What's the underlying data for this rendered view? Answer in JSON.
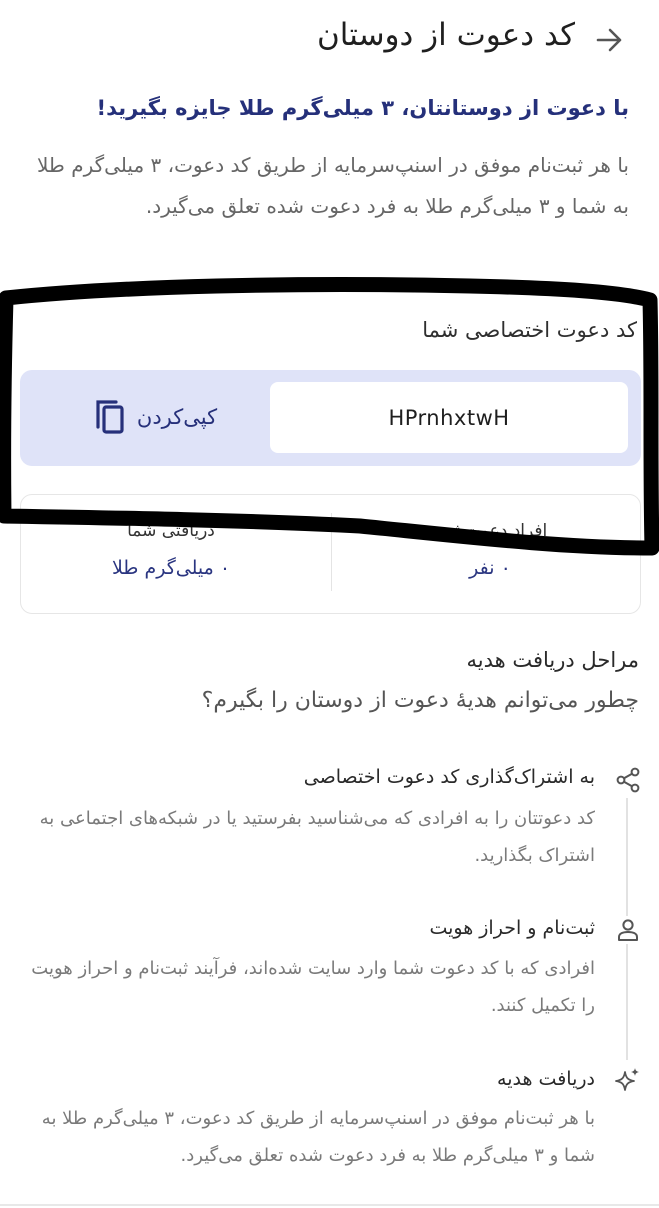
{
  "header": {
    "title": "کد دعوت از دوستان",
    "back_icon": "arrow-right-icon"
  },
  "promo": {
    "headline": "با دعوت از دوستانتان، ۳ میلی‌گرم طلا جایزه بگیرید!",
    "description": "با هر ثبت‌نام موفق در اسنپ‌سرمایه از طریق کد دعوت، ۳ میلی‌گرم طلا به شما و ۳ میلی‌گرم طلا به فرد دعوت شده تعلق می‌گیرد."
  },
  "invite_code": {
    "label": "کد دعوت اختصاصی شما",
    "value": "HPrnhxtwH",
    "copy_label": "کپی‌کردن",
    "copy_icon": "copy-icon"
  },
  "stats": {
    "invited_label": "افراد دعوت‌شده",
    "invited_value": "۰ نفر",
    "received_label": "دریافتی شما",
    "received_value": "۰ میلی‌گرم طلا"
  },
  "steps": {
    "title": "مراحل دریافت هدیه",
    "subtitle": "چطور می‌توانم هدیهٔ دعوت از دوستان را بگیرم؟",
    "items": [
      {
        "icon": "share-icon",
        "title": "به اشتراک‌گذاری کد دعوت اختصاصی",
        "text": "کد دعوتتان را به افرادی که می‌شناسید بفرستید یا در شبکه‌های اجتماعی به اشتراک بگذارید."
      },
      {
        "icon": "user-icon",
        "title": "ثبت‌نام و احراز هویت",
        "text": "افرادی که با کد دعوت شما وارد سایت شده‌اند، فرآیند ثبت‌نام و احراز هویت را تکمیل کنند."
      },
      {
        "icon": "sparkle-icon",
        "title": "دریافت هدیه",
        "text": "با هر ثبت‌نام موفق در اسنپ‌سرمایه از طریق کد دعوت، ۳ میلی‌گرم طلا به شما و ۳ میلی‌گرم طلا به فرد دعوت شده تعلق می‌گیرد."
      }
    ]
  },
  "colors": {
    "accent": "#25307a",
    "code_box_bg": "#dfe3f8",
    "marker": "#000000"
  }
}
